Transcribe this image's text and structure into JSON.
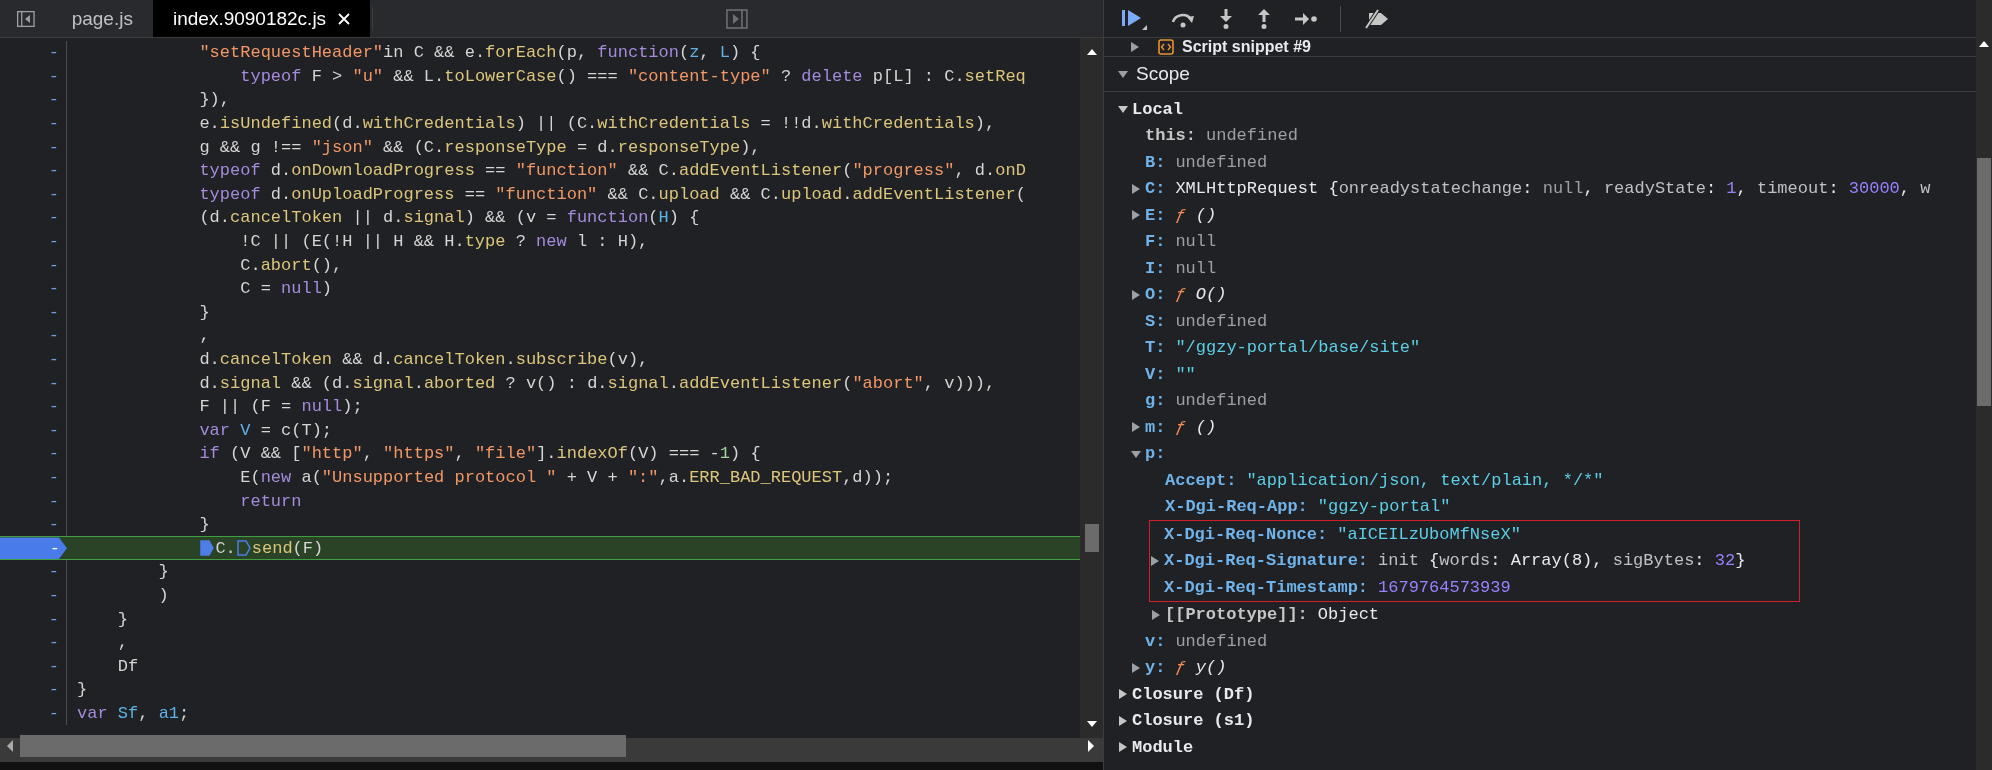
{
  "editor": {
    "tabs": [
      {
        "label": "page.js",
        "selected": false
      },
      {
        "label": "index.9090182c.js",
        "selected": true
      }
    ],
    "lines": [
      {
        "number": "-",
        "current": false,
        "tokens": [
          {
            "t": "            \"setRequestHeader\"",
            "kind": "string"
          },
          {
            "t": "in C && e.",
            "kind": "plain"
          },
          {
            "t": "forEach",
            "kind": "member"
          },
          {
            "t": "(p, ",
            "kind": "plain"
          },
          {
            "t": "function",
            "kind": "keyword"
          },
          {
            "t": "(",
            "kind": "plain"
          },
          {
            "t": "z",
            "kind": "binding"
          },
          {
            "t": ", ",
            "kind": "plain"
          },
          {
            "t": "L",
            "kind": "binding"
          },
          {
            "t": ") {",
            "kind": "plain"
          }
        ]
      },
      {
        "number": "-",
        "current": false,
        "tokens": [
          {
            "t": "                typeof",
            "kind": "keyword"
          },
          {
            "t": " F > ",
            "kind": "plain"
          },
          {
            "t": "\"u\"",
            "kind": "string"
          },
          {
            "t": " && L.",
            "kind": "plain"
          },
          {
            "t": "toLowerCase",
            "kind": "member"
          },
          {
            "t": "() === ",
            "kind": "plain"
          },
          {
            "t": "\"content-type\"",
            "kind": "string"
          },
          {
            "t": " ? ",
            "kind": "plain"
          },
          {
            "t": "delete",
            "kind": "keyword"
          },
          {
            "t": " p[L] : C.",
            "kind": "plain"
          },
          {
            "t": "setReq",
            "kind": "member"
          }
        ]
      },
      {
        "number": "-",
        "current": false,
        "tokens": [
          {
            "t": "            }),",
            "kind": "plain"
          }
        ]
      },
      {
        "number": "-",
        "current": false,
        "tokens": [
          {
            "t": "            e.",
            "kind": "plain"
          },
          {
            "t": "isUndefined",
            "kind": "member"
          },
          {
            "t": "(d.",
            "kind": "plain"
          },
          {
            "t": "withCredentials",
            "kind": "member"
          },
          {
            "t": ") || (C.",
            "kind": "plain"
          },
          {
            "t": "withCredentials",
            "kind": "member"
          },
          {
            "t": " = !!d.",
            "kind": "plain"
          },
          {
            "t": "withCredentials",
            "kind": "member"
          },
          {
            "t": "),",
            "kind": "plain"
          }
        ]
      },
      {
        "number": "-",
        "current": false,
        "tokens": [
          {
            "t": "            g && g !== ",
            "kind": "plain"
          },
          {
            "t": "\"json\"",
            "kind": "string"
          },
          {
            "t": " && (C.",
            "kind": "plain"
          },
          {
            "t": "responseType",
            "kind": "member"
          },
          {
            "t": " = d.",
            "kind": "plain"
          },
          {
            "t": "responseType",
            "kind": "member"
          },
          {
            "t": "),",
            "kind": "plain"
          }
        ]
      },
      {
        "number": "-",
        "current": false,
        "tokens": [
          {
            "t": "            typeof",
            "kind": "keyword"
          },
          {
            "t": " d.",
            "kind": "plain"
          },
          {
            "t": "onDownloadProgress",
            "kind": "member"
          },
          {
            "t": " == ",
            "kind": "plain"
          },
          {
            "t": "\"function\"",
            "kind": "string"
          },
          {
            "t": " && C.",
            "kind": "plain"
          },
          {
            "t": "addEventListener",
            "kind": "member"
          },
          {
            "t": "(",
            "kind": "plain"
          },
          {
            "t": "\"progress\"",
            "kind": "string"
          },
          {
            "t": ", d.",
            "kind": "plain"
          },
          {
            "t": "onD",
            "kind": "member"
          }
        ]
      },
      {
        "number": "-",
        "current": false,
        "tokens": [
          {
            "t": "            typeof",
            "kind": "keyword"
          },
          {
            "t": " d.",
            "kind": "plain"
          },
          {
            "t": "onUploadProgress",
            "kind": "member"
          },
          {
            "t": " == ",
            "kind": "plain"
          },
          {
            "t": "\"function\"",
            "kind": "string"
          },
          {
            "t": " && C.",
            "kind": "plain"
          },
          {
            "t": "upload",
            "kind": "member"
          },
          {
            "t": " && C.",
            "kind": "plain"
          },
          {
            "t": "upload",
            "kind": "member"
          },
          {
            "t": ".",
            "kind": "plain"
          },
          {
            "t": "addEventListener",
            "kind": "member"
          },
          {
            "t": "(",
            "kind": "plain"
          }
        ]
      },
      {
        "number": "-",
        "current": false,
        "tokens": [
          {
            "t": "            (d.",
            "kind": "plain"
          },
          {
            "t": "cancelToken",
            "kind": "member"
          },
          {
            "t": " || d.",
            "kind": "plain"
          },
          {
            "t": "signal",
            "kind": "member"
          },
          {
            "t": ") && (v = ",
            "kind": "plain"
          },
          {
            "t": "function",
            "kind": "keyword"
          },
          {
            "t": "(",
            "kind": "plain"
          },
          {
            "t": "H",
            "kind": "binding"
          },
          {
            "t": ") {",
            "kind": "plain"
          }
        ]
      },
      {
        "number": "-",
        "current": false,
        "tokens": [
          {
            "t": "                !C || (E(!H || H && H.",
            "kind": "plain"
          },
          {
            "t": "type",
            "kind": "member"
          },
          {
            "t": " ? ",
            "kind": "plain"
          },
          {
            "t": "new",
            "kind": "keyword"
          },
          {
            "t": " l : H),",
            "kind": "plain"
          }
        ]
      },
      {
        "number": "-",
        "current": false,
        "tokens": [
          {
            "t": "                C.",
            "kind": "plain"
          },
          {
            "t": "abort",
            "kind": "member"
          },
          {
            "t": "(),",
            "kind": "plain"
          }
        ]
      },
      {
        "number": "-",
        "current": false,
        "tokens": [
          {
            "t": "                C = ",
            "kind": "plain"
          },
          {
            "t": "null",
            "kind": "keyword"
          },
          {
            "t": ")",
            "kind": "plain"
          }
        ]
      },
      {
        "number": "-",
        "current": false,
        "tokens": [
          {
            "t": "            }",
            "kind": "plain"
          }
        ]
      },
      {
        "number": "-",
        "current": false,
        "tokens": [
          {
            "t": "            ,",
            "kind": "plain"
          }
        ]
      },
      {
        "number": "-",
        "current": false,
        "tokens": [
          {
            "t": "            d.",
            "kind": "plain"
          },
          {
            "t": "cancelToken",
            "kind": "member"
          },
          {
            "t": " && d.",
            "kind": "plain"
          },
          {
            "t": "cancelToken",
            "kind": "member"
          },
          {
            "t": ".",
            "kind": "plain"
          },
          {
            "t": "subscribe",
            "kind": "member"
          },
          {
            "t": "(v),",
            "kind": "plain"
          }
        ]
      },
      {
        "number": "-",
        "current": false,
        "tokens": [
          {
            "t": "            d.",
            "kind": "plain"
          },
          {
            "t": "signal",
            "kind": "member"
          },
          {
            "t": " && (d.",
            "kind": "plain"
          },
          {
            "t": "signal",
            "kind": "member"
          },
          {
            "t": ".",
            "kind": "plain"
          },
          {
            "t": "aborted",
            "kind": "member"
          },
          {
            "t": " ? v() : d.",
            "kind": "plain"
          },
          {
            "t": "signal",
            "kind": "member"
          },
          {
            "t": ".",
            "kind": "plain"
          },
          {
            "t": "addEventListener",
            "kind": "member"
          },
          {
            "t": "(",
            "kind": "plain"
          },
          {
            "t": "\"abort\"",
            "kind": "string"
          },
          {
            "t": ", v))),",
            "kind": "plain"
          }
        ]
      },
      {
        "number": "-",
        "current": false,
        "tokens": [
          {
            "t": "            F || (F = ",
            "kind": "plain"
          },
          {
            "t": "null",
            "kind": "keyword"
          },
          {
            "t": ");",
            "kind": "plain"
          }
        ]
      },
      {
        "number": "-",
        "current": false,
        "tokens": [
          {
            "t": "            var ",
            "kind": "keyword"
          },
          {
            "t": "V",
            "kind": "binding"
          },
          {
            "t": " = c(T);",
            "kind": "plain"
          }
        ]
      },
      {
        "number": "-",
        "current": false,
        "tokens": [
          {
            "t": "            if",
            "kind": "keyword"
          },
          {
            "t": " (V && [",
            "kind": "plain"
          },
          {
            "t": "\"http\"",
            "kind": "string"
          },
          {
            "t": ", ",
            "kind": "plain"
          },
          {
            "t": "\"https\"",
            "kind": "string"
          },
          {
            "t": ", ",
            "kind": "plain"
          },
          {
            "t": "\"file\"",
            "kind": "string"
          },
          {
            "t": "].",
            "kind": "plain"
          },
          {
            "t": "indexOf",
            "kind": "member"
          },
          {
            "t": "(V) === -",
            "kind": "plain"
          },
          {
            "t": "1",
            "kind": "number"
          },
          {
            "t": ") {",
            "kind": "plain"
          }
        ]
      },
      {
        "number": "-",
        "current": false,
        "tokens": [
          {
            "t": "                E(",
            "kind": "plain"
          },
          {
            "t": "new",
            "kind": "keyword"
          },
          {
            "t": " a(",
            "kind": "plain"
          },
          {
            "t": "\"Unsupported protocol \"",
            "kind": "string"
          },
          {
            "t": " + V + ",
            "kind": "plain"
          },
          {
            "t": "\":\"",
            "kind": "string"
          },
          {
            "t": ",a.",
            "kind": "plain"
          },
          {
            "t": "ERR_BAD_REQUEST",
            "kind": "member"
          },
          {
            "t": ",d));",
            "kind": "plain"
          }
        ]
      },
      {
        "number": "-",
        "current": false,
        "tokens": [
          {
            "t": "                return",
            "kind": "keyword"
          }
        ]
      },
      {
        "number": "-",
        "current": false,
        "tokens": [
          {
            "t": "            }",
            "kind": "plain"
          }
        ]
      },
      {
        "number": "-",
        "current": true,
        "tokens": [
          {
            "kind": "breakpoint",
            "on": true
          },
          {
            "t": "C.",
            "kind": "plain"
          },
          {
            "kind": "breakpoint",
            "on": false
          },
          {
            "t": "send",
            "kind": "member"
          },
          {
            "t": "(F)",
            "kind": "plain"
          }
        ]
      },
      {
        "number": "-",
        "current": false,
        "tokens": [
          {
            "t": "        }",
            "kind": "plain"
          }
        ]
      },
      {
        "number": "-",
        "current": false,
        "tokens": [
          {
            "t": "        )",
            "kind": "plain"
          }
        ]
      },
      {
        "number": "-",
        "current": false,
        "tokens": [
          {
            "t": "    }",
            "kind": "plain"
          }
        ]
      },
      {
        "number": "-",
        "current": false,
        "tokens": [
          {
            "t": "    ,",
            "kind": "plain"
          }
        ]
      },
      {
        "number": "-",
        "current": false,
        "tokens": [
          {
            "t": "    Df",
            "kind": "plain"
          }
        ]
      },
      {
        "number": "-",
        "current": false,
        "tokens": [
          {
            "t": "}",
            "kind": "plain"
          }
        ]
      },
      {
        "number": "-",
        "current": false,
        "tokens": [
          {
            "t": "var ",
            "kind": "keyword"
          },
          {
            "t": "Sf",
            "kind": "binding"
          },
          {
            "t": ", ",
            "kind": "plain"
          },
          {
            "t": "a1",
            "kind": "binding"
          },
          {
            "t": ";",
            "kind": "plain"
          }
        ]
      }
    ]
  },
  "toolbar": [
    {
      "kind": "resume"
    },
    {
      "kind": "step-over"
    },
    {
      "kind": "step-into"
    },
    {
      "kind": "step-out"
    },
    {
      "kind": "step"
    },
    {
      "kind": "deactivate"
    }
  ],
  "call_stack_item": {
    "label": "Script snippet #9",
    "expanded": false
  },
  "scope": {
    "label": "Scope",
    "expanded": true,
    "groups": [
      {
        "label": "Local",
        "expanded": true,
        "entries": [
          {
            "name": "this:",
            "internal": true,
            "value": [
              {
                "t": "undefined",
                "kind": "undef"
              }
            ]
          },
          {
            "name": "B:",
            "internal": false,
            "value": [
              {
                "t": "undefined",
                "kind": "undef"
              }
            ]
          },
          {
            "name": "C:",
            "internal": false,
            "expanded": false,
            "value": [
              {
                "t": "XMLHttpRequest {",
                "kind": "text"
              },
              {
                "t": "onreadystatechange",
                "kind": "key"
              },
              {
                "t": ": ",
                "kind": "text"
              },
              {
                "t": "null",
                "kind": "undef"
              },
              {
                "t": ", ",
                "kind": "text"
              },
              {
                "t": "readyState",
                "kind": "key"
              },
              {
                "t": ": ",
                "kind": "text"
              },
              {
                "t": "1",
                "kind": "number"
              },
              {
                "t": ", ",
                "kind": "text"
              },
              {
                "t": "timeout",
                "kind": "key"
              },
              {
                "t": ": ",
                "kind": "text"
              },
              {
                "t": "30000",
                "kind": "number"
              },
              {
                "t": ", ",
                "kind": "text"
              },
              {
                "t": "w",
                "kind": "key"
              }
            ]
          },
          {
            "name": "E:",
            "internal": false,
            "expanded": false,
            "value": [
              {
                "t": "ƒ",
                "kind": "func"
              },
              {
                "t": " ()",
                "kind": "signature"
              }
            ]
          },
          {
            "name": "F:",
            "internal": false,
            "value": [
              {
                "t": "null",
                "kind": "undef"
              }
            ]
          },
          {
            "name": "I:",
            "internal": false,
            "value": [
              {
                "t": "null",
                "kind": "undef"
              }
            ]
          },
          {
            "name": "O:",
            "internal": false,
            "expanded": false,
            "value": [
              {
                "t": "ƒ",
                "kind": "func"
              },
              {
                "t": " O()",
                "kind": "signature"
              }
            ]
          },
          {
            "name": "S:",
            "internal": false,
            "value": [
              {
                "t": "undefined",
                "kind": "undef"
              }
            ]
          },
          {
            "name": "T:",
            "internal": false,
            "value": [
              {
                "t": "\"/ggzy-portal/base/site\"",
                "kind": "string"
              }
            ]
          },
          {
            "name": "V:",
            "internal": false,
            "value": [
              {
                "t": "\"\"",
                "kind": "string"
              }
            ]
          },
          {
            "name": "g:",
            "internal": false,
            "value": [
              {
                "t": "undefined",
                "kind": "undef"
              }
            ]
          },
          {
            "name": "m:",
            "internal": false,
            "expanded": false,
            "value": [
              {
                "t": "ƒ",
                "kind": "func"
              },
              {
                "t": " ()",
                "kind": "signature"
              }
            ]
          },
          {
            "name": "p:",
            "internal": false,
            "expanded": true,
            "children": [
              {
                "name": "Accept:",
                "internal": false,
                "marked": false,
                "value": [
                  {
                    "t": "\"application/json, text/plain, */*\"",
                    "kind": "string"
                  }
                ]
              },
              {
                "name": "X-Dgi-Req-App:",
                "internal": false,
                "marked": false,
                "value": [
                  {
                    "t": "\"ggzy-portal\"",
                    "kind": "string"
                  }
                ]
              },
              {
                "name": "X-Dgi-Req-Nonce:",
                "internal": false,
                "marked": true,
                "value": [
                  {
                    "t": "\"aICEILzUboMfNseX\"",
                    "kind": "string"
                  }
                ]
              },
              {
                "name": "X-Dgi-Req-Signature:",
                "internal": false,
                "marked": true,
                "expanded": false,
                "value": [
                  {
                    "t": "init ",
                    "kind": "key"
                  },
                  {
                    "t": "{",
                    "kind": "text"
                  },
                  {
                    "t": "words",
                    "kind": "key"
                  },
                  {
                    "t": ": ",
                    "kind": "text"
                  },
                  {
                    "t": "Array(8)",
                    "kind": "text"
                  },
                  {
                    "t": ", ",
                    "kind": "text"
                  },
                  {
                    "t": "sigBytes",
                    "kind": "key"
                  },
                  {
                    "t": ": ",
                    "kind": "text"
                  },
                  {
                    "t": "32",
                    "kind": "number"
                  },
                  {
                    "t": "}",
                    "kind": "text"
                  }
                ]
              },
              {
                "name": "X-Dgi-Req-Timestamp:",
                "internal": false,
                "marked": true,
                "value": [
                  {
                    "t": "1679764573939",
                    "kind": "number"
                  }
                ]
              },
              {
                "name": "[[Prototype]]:",
                "internal": true,
                "marked": false,
                "expanded": false,
                "value": [
                  {
                    "t": "Object",
                    "kind": "text"
                  }
                ]
              }
            ]
          },
          {
            "name": "v:",
            "internal": false,
            "value": [
              {
                "t": "undefined",
                "kind": "undef"
              }
            ]
          },
          {
            "name": "y:",
            "internal": false,
            "expanded": false,
            "value": [
              {
                "t": "ƒ",
                "kind": "func"
              },
              {
                "t": " y()",
                "kind": "signature"
              }
            ]
          }
        ]
      },
      {
        "label": "Closure (Df)",
        "expanded": false
      },
      {
        "label": "Closure (s1)",
        "expanded": false
      },
      {
        "label": "Module",
        "expanded": false
      }
    ]
  }
}
